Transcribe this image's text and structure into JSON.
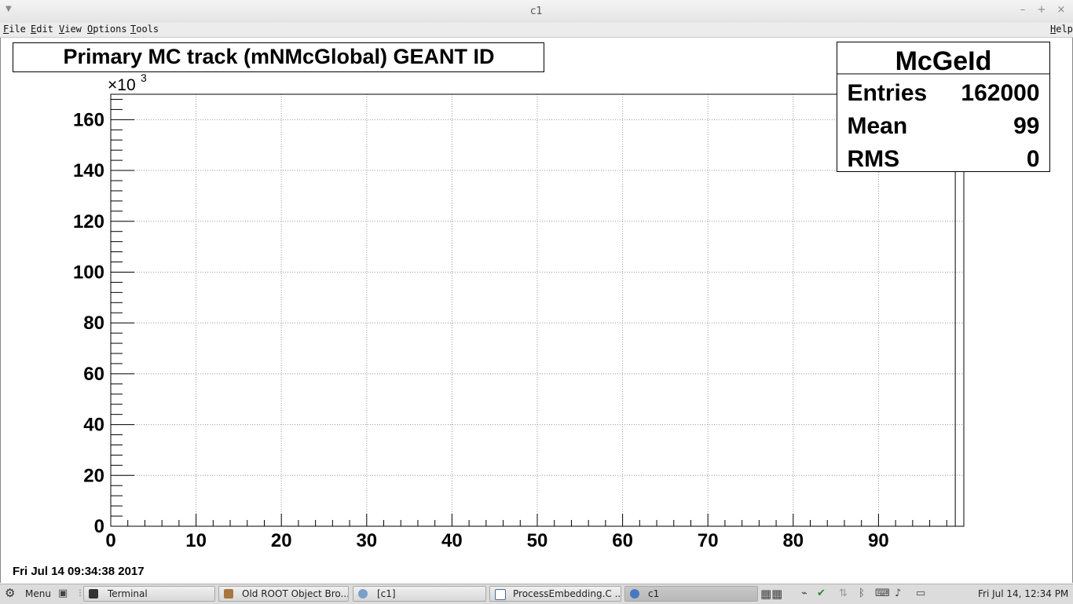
{
  "window": {
    "title": "c1",
    "minimize": "–",
    "maximize": "+",
    "close": "×"
  },
  "menubar": {
    "items": [
      {
        "key": "F",
        "rest": "ile"
      },
      {
        "key": "E",
        "rest": "dit"
      },
      {
        "key": "V",
        "rest": "iew"
      },
      {
        "key": "O",
        "rest": "ptions"
      },
      {
        "key": "T",
        "rest": "ools"
      }
    ],
    "help": {
      "key": "H",
      "rest": "elp"
    }
  },
  "stats": {
    "name": "McGeId",
    "entries_label": "Entries",
    "entries_value": "162000",
    "mean_label": "Mean",
    "mean_value": "99",
    "rms_label": "RMS",
    "rms_value": "0"
  },
  "chart_data": {
    "type": "bar",
    "title": "Primary MC track (mNMcGlobal) GEANT ID",
    "xlabel": "",
    "ylabel": "",
    "xlim": [
      0,
      100
    ],
    "ylim": [
      0,
      170000
    ],
    "y_multiplier_label": "×10",
    "y_multiplier_exp": "3",
    "x_ticks": [
      "0",
      "10",
      "20",
      "30",
      "40",
      "50",
      "60",
      "70",
      "80",
      "90"
    ],
    "y_ticks": [
      "0",
      "20",
      "40",
      "60",
      "80",
      "100",
      "120",
      "140",
      "160"
    ],
    "grid": true,
    "bins": [
      {
        "x": 99,
        "value": 162000
      }
    ]
  },
  "date_stamp": "Fri Jul 14 09:34:38 2017",
  "taskbar": {
    "menu_label": "Menu",
    "items": [
      {
        "label": "Terminal"
      },
      {
        "label": "Old ROOT Object Bro..."
      },
      {
        "label": "[c1]"
      },
      {
        "label": "ProcessEmbedding.C ..."
      },
      {
        "label": "c1"
      }
    ],
    "clock": "Fri Jul 14, 12:34 PM"
  }
}
